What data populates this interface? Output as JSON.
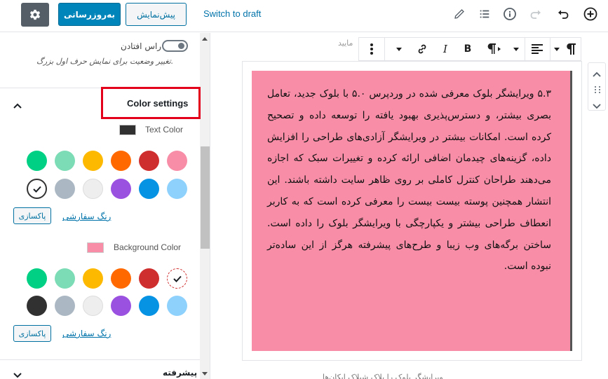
{
  "toolbar": {
    "update_label": "به‌روزرسانی",
    "preview_label": "پیش‌نمایش",
    "switch_draft_label": "Switch to draft",
    "icons": [
      "gear-icon",
      "pencil-icon",
      "list-view-icon",
      "info-icon",
      "redo-icon",
      "undo-icon",
      "add-block-icon"
    ]
  },
  "sidebar": {
    "drop_cap_label": "راس افتادن",
    "drop_cap_help": "تغییر وضعیت برای نمایش حرف اول بزرگ.",
    "color_settings_title": "Color settings",
    "text_color": {
      "label": "Text Color",
      "current": "#313131",
      "custom_link": "رنگ سفارشی",
      "clear_label": "پاکسازی",
      "palette": [
        "#f78da7",
        "#cf2e2e",
        "#ff6900",
        "#fcb900",
        "#7bdcb5",
        "#00d084",
        "#8ed1fc",
        "#0693e3",
        "#9b51e0",
        "#eeeeee",
        "#abb8c3",
        "#ffffff"
      ],
      "selected": "#ffffff"
    },
    "background_color": {
      "label": "Background Color",
      "current": "#f78da7",
      "custom_link": "رنگ سفارشی",
      "clear_label": "پاکسازی",
      "palette": [
        "#ffffff",
        "#cf2e2e",
        "#ff6900",
        "#fcb900",
        "#7bdcb5",
        "#00d084",
        "#8ed1fc",
        "#0693e3",
        "#9b51e0",
        "#eeeeee",
        "#abb8c3",
        "#313131"
      ],
      "selected": "#f78da7"
    },
    "advanced_label": "پیشرفته"
  },
  "editor": {
    "partial_text": "مایید",
    "paragraph": "۵.۳ ویرایشگر بلوک معرفی شده در وردپرس ۵.۰ با بلوک جدید، تعامل بصری بیشتر، و دسترس‌پذیری بهبود یافته را توسعه داده و تصحیح کرده است. امکانات بیشتر در ویرایشگر آزادی‌های طراحی را افزایش داده، گزینه‌های چیدمان اضافی ارائه کرده و تغییرات سبک که اجازه می‌دهند طراحان کنترل کاملی بر روی ظاهر سایت داشته باشند. این انتشار همچنین پوسته بیست بیست را معرفی کرده است که به کاربر انعطاف طراحی بیشتر و یکپارچگی با ویرایشگر بلوک را داده است. ساختن برگه‌های وب زیبا و طرح‌های پیشرفته هرگز از این سادەتر نبوده است.",
    "bottom_text": "ویرایشگر بلوک را بلاک شیلاک ایکان‌ها",
    "block_toolbar_icons": [
      "paragraph-icon",
      "align-icon",
      "dropdown-icon",
      "rtl-icon",
      "bold-icon",
      "italic-icon",
      "link-icon",
      "more-dropdown-icon",
      "more-options-icon"
    ]
  }
}
